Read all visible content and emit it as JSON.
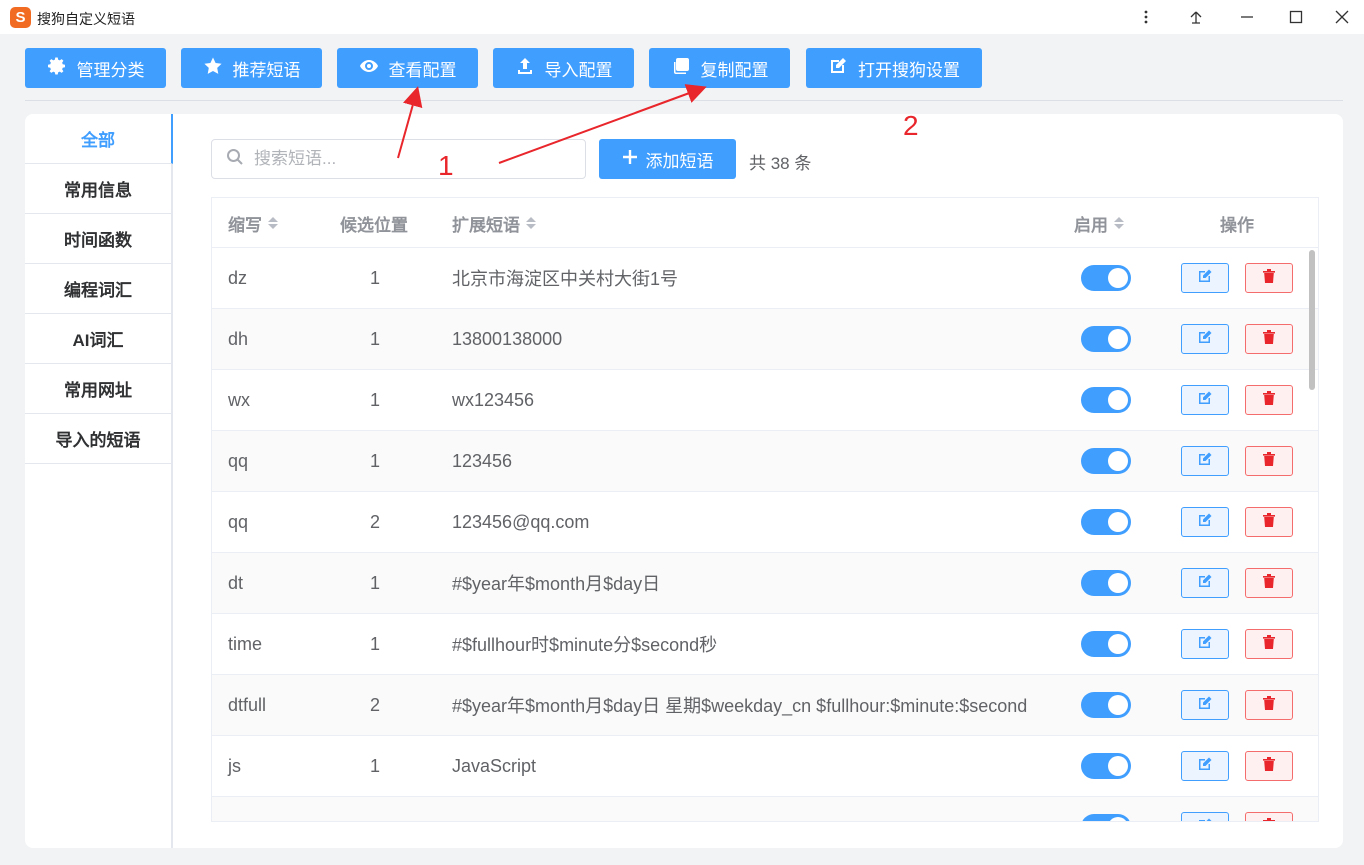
{
  "window": {
    "title": "搜狗自定义短语",
    "logo": "S"
  },
  "toolbar": {
    "buttons": [
      {
        "label": "管理分类",
        "icon": "gear-icon"
      },
      {
        "label": "推荐短语",
        "icon": "star-icon"
      },
      {
        "label": "查看配置",
        "icon": "eye-icon"
      },
      {
        "label": "导入配置",
        "icon": "upload-icon"
      },
      {
        "label": "复制配置",
        "icon": "copy-icon"
      },
      {
        "label": "打开搜狗设置",
        "icon": "edit-icon"
      }
    ]
  },
  "sidebar": {
    "items": [
      {
        "label": "全部",
        "active": true
      },
      {
        "label": "常用信息"
      },
      {
        "label": "时间函数"
      },
      {
        "label": "编程词汇"
      },
      {
        "label": "AI词汇"
      },
      {
        "label": "常用网址"
      },
      {
        "label": "导入的短语"
      }
    ]
  },
  "search": {
    "placeholder": "搜索短语..."
  },
  "add_button": {
    "label": "添加短语"
  },
  "total": "共 38 条",
  "table": {
    "columns": [
      "缩写",
      "候选位置",
      "扩展短语",
      "启用",
      "操作"
    ],
    "rows": [
      {
        "abbr": "dz",
        "position": "1",
        "phrase": "北京市海淀区中关村大街1号",
        "enabled": true
      },
      {
        "abbr": "dh",
        "position": "1",
        "phrase": "13800138000",
        "enabled": true
      },
      {
        "abbr": "wx",
        "position": "1",
        "phrase": "wx123456",
        "enabled": true
      },
      {
        "abbr": "qq",
        "position": "1",
        "phrase": "123456",
        "enabled": true
      },
      {
        "abbr": "qq",
        "position": "2",
        "phrase": "123456@qq.com",
        "enabled": true
      },
      {
        "abbr": "dt",
        "position": "1",
        "phrase": "#$year年$month月$day日",
        "enabled": true
      },
      {
        "abbr": "time",
        "position": "1",
        "phrase": "#$fullhour时$minute分$second秒",
        "enabled": true
      },
      {
        "abbr": "dtfull",
        "position": "2",
        "phrase": "#$year年$month月$day日 星期$weekday_cn $fullhour:$minute:$second",
        "enabled": true
      },
      {
        "abbr": "js",
        "position": "1",
        "phrase": "JavaScript",
        "enabled": true
      },
      {
        "abbr": "",
        "position": "",
        "phrase": "",
        "enabled": true
      }
    ]
  },
  "annotations": {
    "label_1": "1",
    "label_2": "2"
  },
  "colors": {
    "primary": "#409eff",
    "danger": "#f56c6c",
    "annotation": "#e8262b"
  }
}
